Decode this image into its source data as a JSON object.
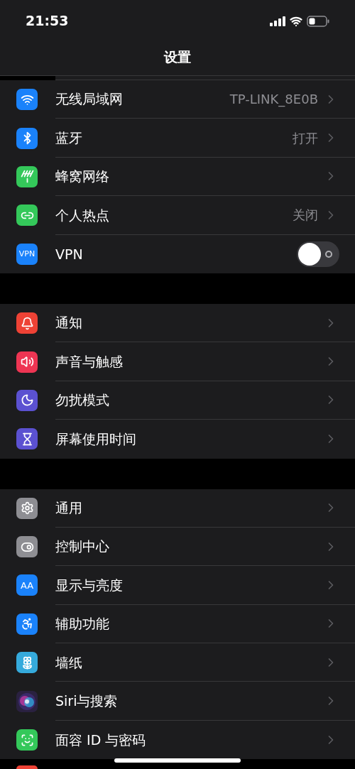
{
  "status_bar": {
    "time": "21:53"
  },
  "title": "设置",
  "groups": [
    {
      "rows": [
        {
          "kind": "link",
          "label": "无线局域网",
          "value": "TP-LINK_8E0B",
          "color": "#1a82fb"
        },
        {
          "kind": "link",
          "label": "蓝牙",
          "value": "打开",
          "color": "#1a82fb"
        },
        {
          "kind": "link",
          "label": "蜂窝网络",
          "color": "#34c85a"
        },
        {
          "kind": "link",
          "label": "个人热点",
          "value": "关闭",
          "color": "#34c85a"
        },
        {
          "kind": "toggle",
          "label": "VPN",
          "on": false,
          "color": "#1a82fb",
          "icon_text": "VPN"
        }
      ]
    },
    {
      "rows": [
        {
          "kind": "link",
          "label": "通知",
          "color": "#ee4235"
        },
        {
          "kind": "link",
          "label": "声音与触感",
          "color": "#ee3553"
        },
        {
          "kind": "link",
          "label": "勿扰模式",
          "color": "#5b51d1"
        },
        {
          "kind": "link",
          "label": "屏幕使用时间",
          "color": "#5b51d1"
        }
      ]
    },
    {
      "rows": [
        {
          "kind": "link",
          "label": "通用",
          "color": "#8e8e93"
        },
        {
          "kind": "link",
          "label": "控制中心",
          "color": "#8e8e93"
        },
        {
          "kind": "link",
          "label": "显示与亮度",
          "color": "#1a82fb",
          "icon_text": "AA"
        },
        {
          "kind": "link",
          "label": "辅助功能",
          "color": "#1a82fb"
        },
        {
          "kind": "link",
          "label": "墙纸",
          "color": "#35aadc"
        },
        {
          "kind": "link",
          "label": "Siri与搜索",
          "color": "#2a2140"
        },
        {
          "kind": "link",
          "label": "面容 ID 与密码",
          "color": "#34c85a"
        },
        {
          "kind": "partial",
          "color": "#ee4235"
        }
      ]
    }
  ]
}
